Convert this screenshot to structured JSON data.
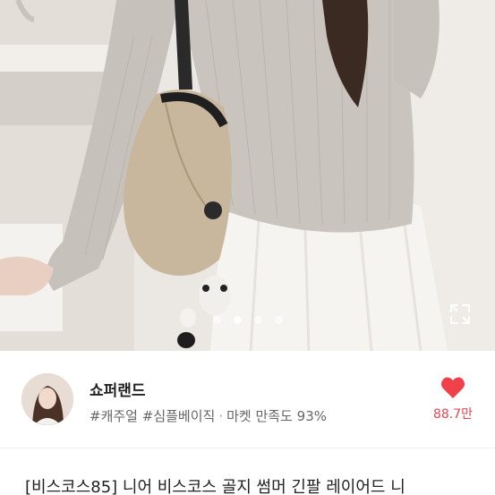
{
  "carousel": {
    "total_slides": 4,
    "active_index": 1
  },
  "shop": {
    "name": "쇼퍼랜드",
    "tags": [
      "#캐주얼",
      "#심플베이직"
    ],
    "satisfaction_label": "마켓 만족도 93%",
    "like_count": "88.7만"
  },
  "product": {
    "title": "[비스코스85] 니어 비스코스 골지 썸머 긴팔 레이어드 니"
  },
  "colors": {
    "heart": "#f0404a",
    "like_text": "#e8454f"
  },
  "icons": {
    "expand": "expand-icon",
    "heart": "heart-icon"
  }
}
